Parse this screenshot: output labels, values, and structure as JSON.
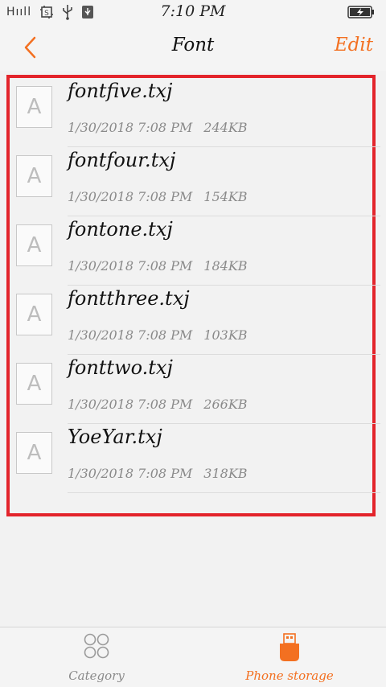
{
  "status_bar": {
    "signal": "Hııll",
    "time": "7:10 PM"
  },
  "header": {
    "title": "Font",
    "edit_label": "Edit"
  },
  "files": [
    {
      "name": "fontfive.txj",
      "date": "1/30/2018 7:08 PM",
      "size": "244KB",
      "thumb": "A"
    },
    {
      "name": "fontfour.txj",
      "date": "1/30/2018 7:08 PM",
      "size": "154KB",
      "thumb": "A"
    },
    {
      "name": "fontone.txj",
      "date": "1/30/2018 7:08 PM",
      "size": "184KB",
      "thumb": "A"
    },
    {
      "name": "fontthree.txj",
      "date": "1/30/2018 7:08 PM",
      "size": "103KB",
      "thumb": "A"
    },
    {
      "name": "fonttwo.txj",
      "date": "1/30/2018 7:08 PM",
      "size": "266KB",
      "thumb": "A"
    },
    {
      "name": "YoeYar.txj",
      "date": "1/30/2018 7:08 PM",
      "size": "318KB",
      "thumb": "A"
    }
  ],
  "tabbar": {
    "category_label": "Category",
    "storage_label": "Phone storage"
  },
  "colors": {
    "accent": "#f37021",
    "highlight_border": "#e3242b",
    "inactive": "#8a8a8a"
  },
  "icons": {
    "back": "chevron-left-icon",
    "category": "four-circles-icon",
    "storage": "usb-drive-icon"
  }
}
